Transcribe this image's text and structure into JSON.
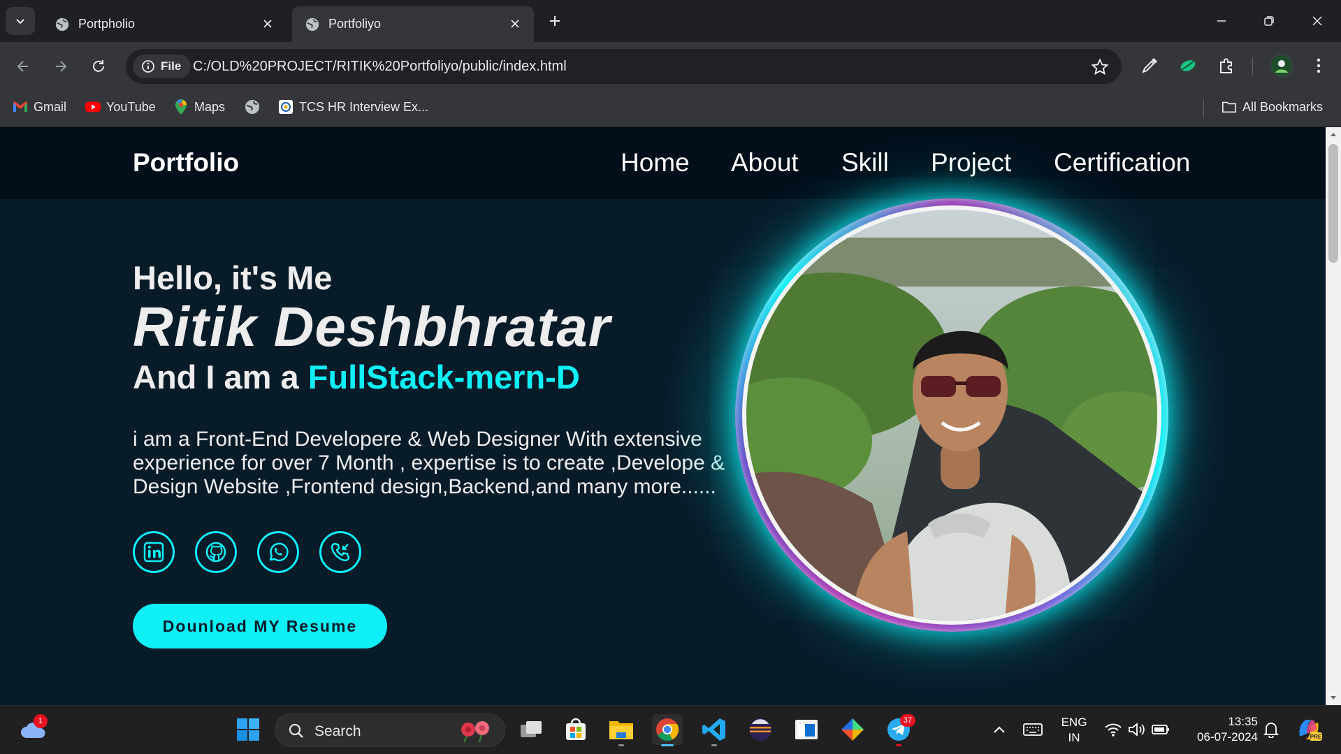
{
  "browser": {
    "tabs": [
      {
        "title": "Portpholio",
        "active": false
      },
      {
        "title": "Portfoliyo",
        "active": true
      }
    ],
    "omnibox": {
      "scheme_chip": "File",
      "url": "C:/OLD%20PROJECT/RITIK%20Portfoliyo/public/index.html"
    },
    "bookmarks": [
      {
        "label": "Gmail",
        "icon": "gmail-icon"
      },
      {
        "label": "YouTube",
        "icon": "youtube-icon"
      },
      {
        "label": "Maps",
        "icon": "maps-icon"
      },
      {
        "label": "",
        "icon": "globe-icon"
      },
      {
        "label": "TCS HR Interview Ex...",
        "icon": "tcs-icon"
      }
    ],
    "all_bookmarks": "All Bookmarks"
  },
  "site": {
    "logo": "Portfolio",
    "nav": [
      "Home",
      "About",
      "Skill",
      "Project",
      "Certification"
    ],
    "hero": {
      "greeting": "Hello, it's Me",
      "name": "Ritik Deshbhratar",
      "role_prefix": "And I am a ",
      "role_accent": "FullStack-mern-D",
      "description": "i am a Front-End Developere & Web Designer With extensive experience for over 7 Month , expertise is to create ,Develope & Design Website ,Frontend design,Backend,and many more......",
      "socials": [
        "linkedin-icon",
        "github-icon",
        "whatsapp-icon",
        "phone-icon"
      ],
      "cta": "Dounload MY Resume"
    },
    "colors": {
      "accent": "#0ef0f5",
      "background": "#081b29",
      "header": "#020f1b"
    }
  },
  "taskbar": {
    "search_placeholder": "Search",
    "weather_badge": "1",
    "telegram_badge": "37",
    "language": "ENG",
    "region": "IN",
    "time": "13:35",
    "date": "06-07-2024"
  }
}
